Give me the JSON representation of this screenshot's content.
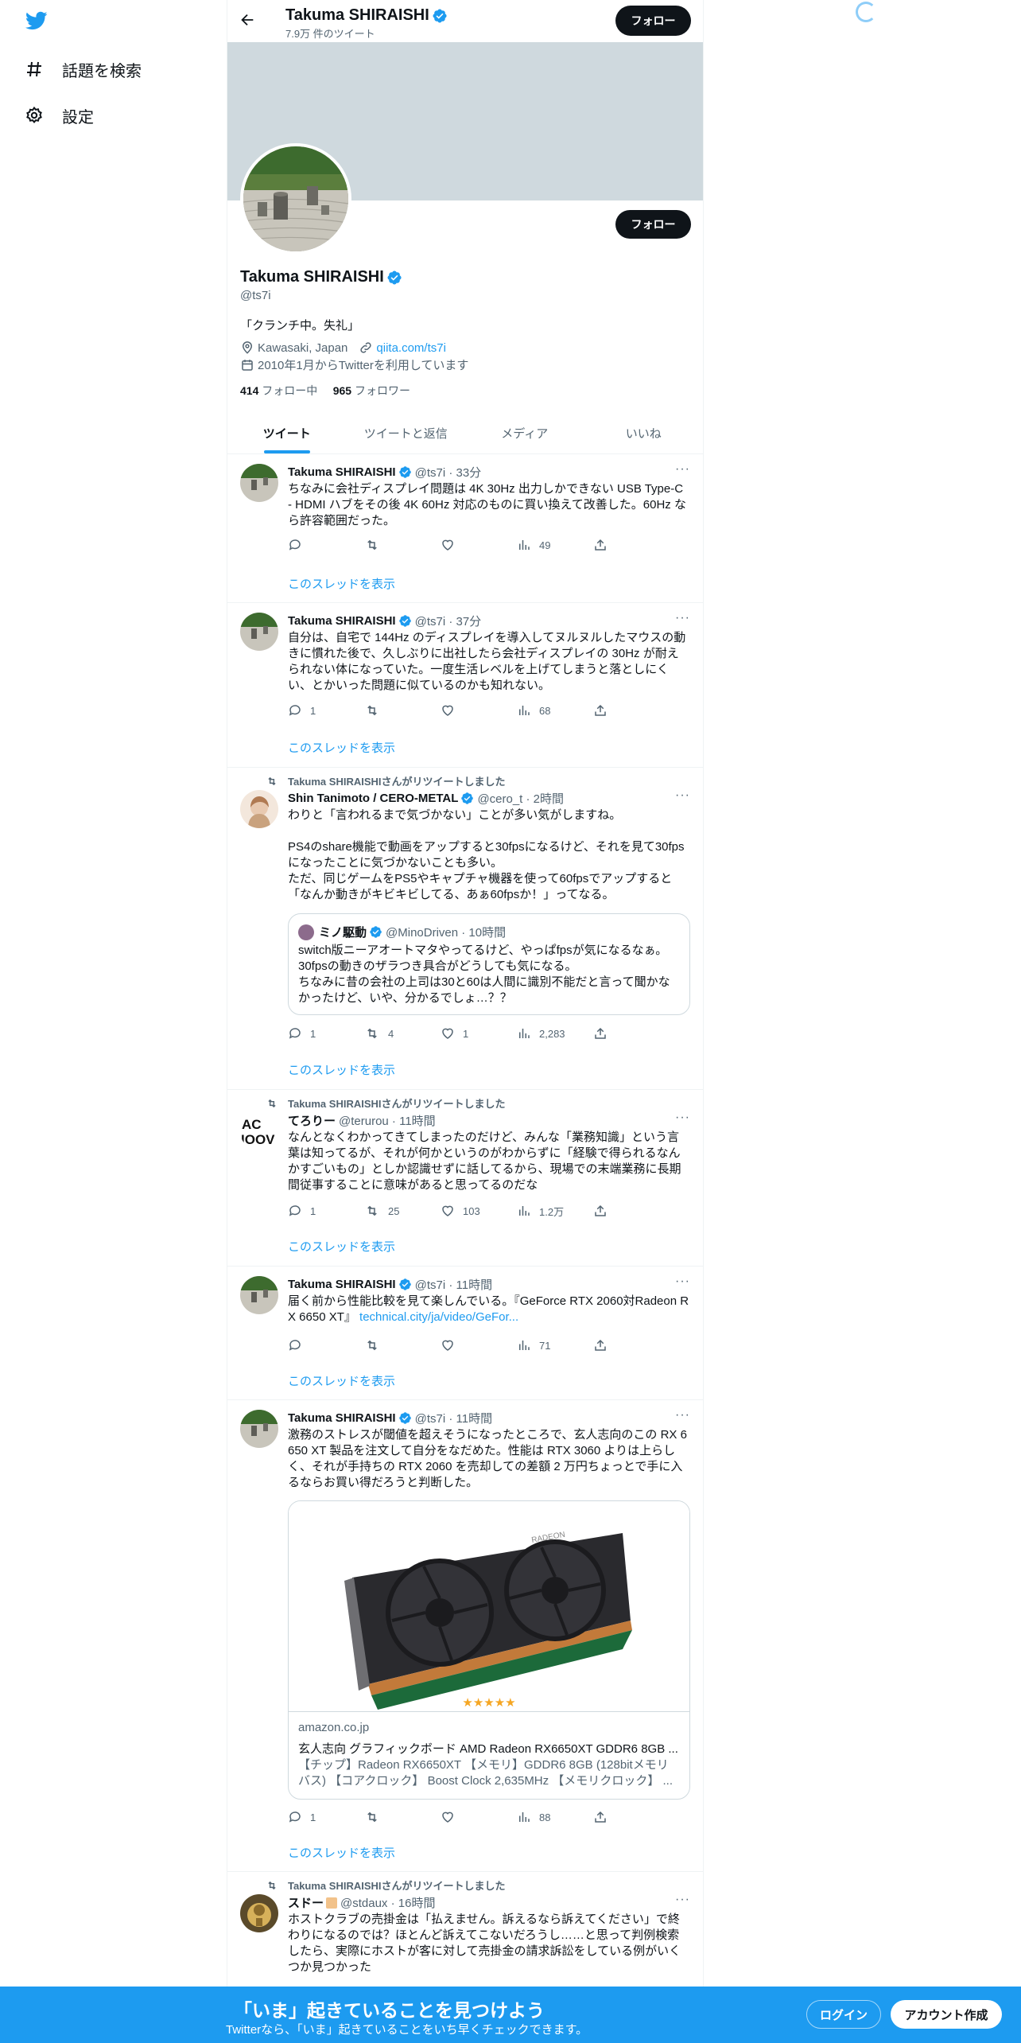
{
  "nav": {
    "explore_label": "話題を検索",
    "settings_label": "設定"
  },
  "header": {
    "name": "Takuma SHIRAISHI",
    "tweet_count": "7.9万 件のツイート",
    "follow_label": "フォロー"
  },
  "profile": {
    "name": "Takuma SHIRAISHI",
    "handle": "@ts7i",
    "bio": "「クランチ中。失礼」",
    "location": "Kawasaki, Japan",
    "url": "qiita.com/ts7i",
    "joined": "2010年1月からTwitterを利用しています",
    "following_count": "414",
    "following_label": "フォロー中",
    "followers_count": "965",
    "followers_label": "フォロワー",
    "follow_label": "フォロー"
  },
  "tabs": [
    {
      "label": "ツイート"
    },
    {
      "label": "ツイートと返信"
    },
    {
      "label": "メディア"
    },
    {
      "label": "いいね"
    }
  ],
  "show_thread": "このスレッドを表示",
  "tweets": [
    {
      "name": "Takuma SHIRAISHI",
      "meta": "@ts7i · 33分",
      "body": "ちなみに会社ディスプレイ問題は 4K 30Hz 出力しかできない USB Type-C - HDMI ハブをその後 4K 60Hz 対応のものに買い換えて改善した。60Hz なら許容範囲だった。",
      "reply": "",
      "retweet": "",
      "like": "",
      "views": "49"
    },
    {
      "name": "Takuma SHIRAISHI",
      "meta": "@ts7i · 37分",
      "body": "自分は、自宅で 144Hz のディスプレイを導入してヌルヌルしたマウスの動きに慣れた後で、久しぶりに出社したら会社ディスプレイの 30Hz が耐えられない体になっていた。一度生活レベルを上げてしまうと落としにくい、とかいった問題に似ているのかも知れない。",
      "reply": "1",
      "retweet": "",
      "like": "",
      "views": "68"
    },
    {
      "retweeted_by": "Takuma SHIRAISHIさんがリツイートしました",
      "name": "Shin Tanimoto / CERO-METAL",
      "meta": "@cero_t · 2時間",
      "body": "わりと「言われるまで気づかない」ことが多い気がしますね。\n\nPS4のshare機能で動画をアップすると30fpsになるけど、それを見て30fpsになったことに気づかないことも多い。\nただ、同じゲームをPS5やキャプチャ機器を使って60fpsでアップすると「なんか動きがキビキビしてる、あぁ60fpsか！」ってなる。",
      "quote": {
        "name": "ミノ駆動",
        "meta": "@MinoDriven · 10時間",
        "body": "switch版ニーアオートマタやってるけど、やっぱfpsが気になるなぁ。30fpsの動きのザラつき具合がどうしても気になる。\nちなみに昔の会社の上司は30と60は人間に識別不能だと言って聞かなかったけど、いや、分かるでしょ…？？"
      },
      "reply": "1",
      "retweet": "4",
      "like": "1",
      "views": "2,283"
    },
    {
      "retweeted_by": "Takuma SHIRAISHIさんがリツイートしました",
      "name": "てろりー",
      "meta": "@terurou · 11時間",
      "body": "なんとなくわかってきてしまったのだけど、みんな「業務知識」という言葉は知ってるが、それが何かというのがわからずに「経験で得られるなんかすごいもの」としか認識せずに話してるから、現場での末端業務に長期間従事することに意味があると思ってるのだな",
      "reply": "1",
      "retweet": "25",
      "like": "103",
      "views": "1.2万"
    },
    {
      "name": "Takuma SHIRAISHI",
      "meta": "@ts7i · 11時間",
      "body": "届く前から性能比較を見て楽しんでいる。『GeForce RTX 2060対Radeon RX 6650 XT』 ",
      "link": "technical.city/ja/video/GeFor...",
      "reply": "",
      "retweet": "",
      "like": "",
      "views": "71"
    },
    {
      "name": "Takuma SHIRAISHI",
      "meta": "@ts7i · 11時間",
      "body": "激務のストレスが閾値を超えそうになったところで、玄人志向のこの RX 6650 XT 製品を注文して自分をなだめた。性能は RTX 3060 よりは上らしく、それが手持ちの RTX 2060 を売却しての差額 2 万円ちょっとで手に入るならお買い得だろうと判断した。",
      "card": {
        "rating": "★★★★★",
        "domain": "amazon.co.jp",
        "title": "玄人志向 グラフィックボード AMD Radeon RX6650XT GDDR6 8GB ...",
        "desc": "【チップ】Radeon RX6650XT 【メモリ】GDDR6 8GB (128bitメモリバス) 【コアクロック】 Boost Clock 2,635MHz 【メモリクロック】 ..."
      },
      "reply": "1",
      "retweet": "",
      "like": "",
      "views": "88"
    },
    {
      "retweeted_by": "Takuma SHIRAISHIさんがリツイートしました",
      "name": "スドー",
      "meta": "@stdaux · 16時間",
      "body": "ホストクラブの売掛金は「払えません。訴えるなら訴えてください」で終わりになるのでは？ほとんど訴えてこないだろうし……と思って判例検索したら、実際にホストが客に対して売掛金の請求訴訟をしている例がいくつか見つかった"
    }
  ],
  "bottom": {
    "title": "「いま」起きていることを見つけよう",
    "subtitle": "Twitterなら、「いま」起きていることをいち早くチェックできます。",
    "login": "ログイン",
    "signup": "アカウント作成"
  },
  "colors": {
    "accent": "#1d9bf0",
    "banner": "#cfd9de",
    "text": "#0f1419",
    "muted": "#536471"
  }
}
